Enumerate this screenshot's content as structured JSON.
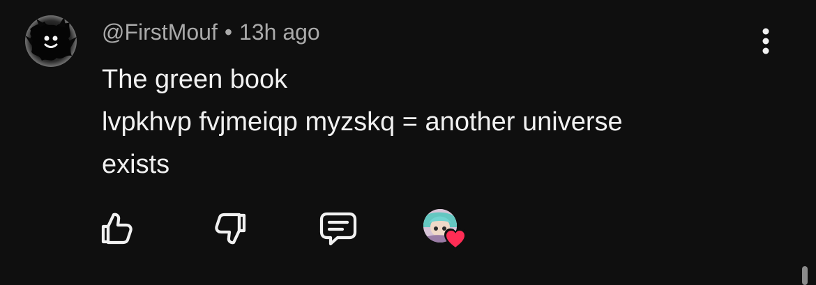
{
  "comment": {
    "author": "@FirstMouf",
    "separator": "•",
    "time": "13h ago",
    "lines": [
      "The green book",
      "lvpkhvp fvjmeiqp myzskq = another universe",
      "exists"
    ]
  },
  "icons": {
    "menu": "more-vertical-icon",
    "like": "thumbs-up-icon",
    "dislike": "thumbs-down-icon",
    "reply": "reply-icon",
    "creator": "creator-heart-icon"
  },
  "colors": {
    "background": "#0f0f0f",
    "primary_text": "#f1f1f1",
    "secondary_text": "#aaaaaa",
    "heart": "#ff2d55"
  }
}
